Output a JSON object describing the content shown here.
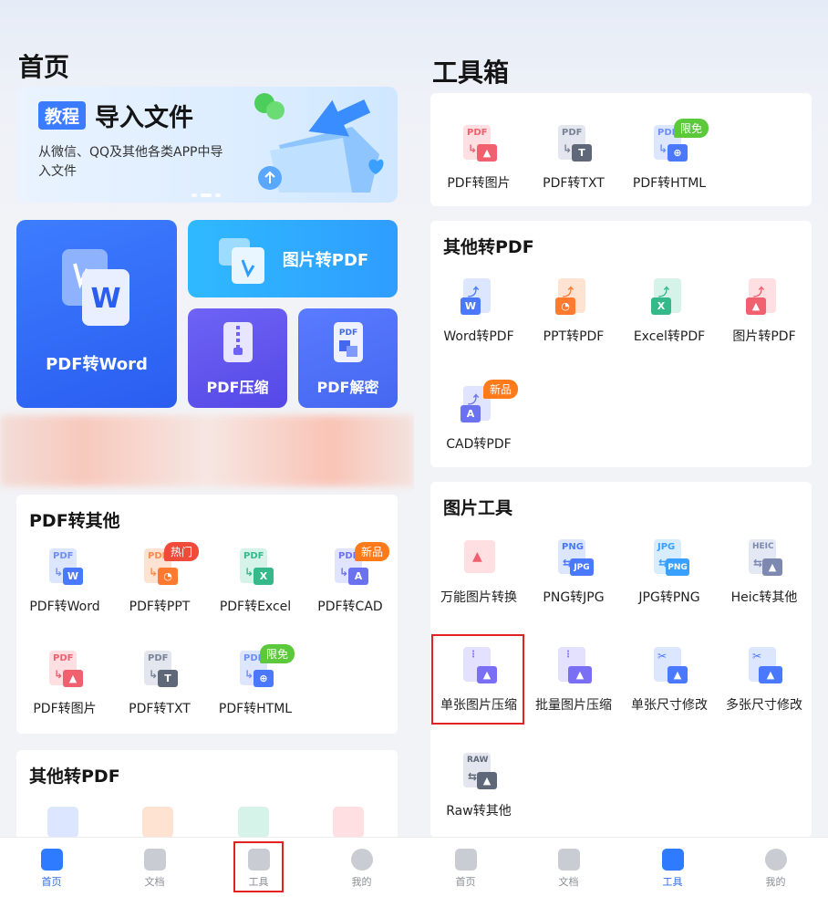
{
  "left": {
    "title": "首页",
    "banner": {
      "tag": "教程",
      "title": "导入文件",
      "subtitle": "从微信、QQ及其他各类APP中导入文件"
    },
    "tiles": {
      "pdf_to_word": "PDF转Word",
      "image_to_pdf": "图片转PDF",
      "pdf_compress": "PDF压缩",
      "pdf_decrypt": "PDF解密"
    },
    "section_pdf_other": {
      "title": "PDF转其他",
      "items": [
        {
          "label": "PDF转Word",
          "icon": "pdf-to-word-icon",
          "badge": ""
        },
        {
          "label": "PDF转PPT",
          "icon": "pdf-to-ppt-icon",
          "badge": "热门"
        },
        {
          "label": "PDF转Excel",
          "icon": "pdf-to-excel-icon",
          "badge": ""
        },
        {
          "label": "PDF转CAD",
          "icon": "pdf-to-cad-icon",
          "badge": "新品"
        },
        {
          "label": "PDF转图片",
          "icon": "pdf-to-image-icon",
          "badge": ""
        },
        {
          "label": "PDF转TXT",
          "icon": "pdf-to-txt-icon",
          "badge": ""
        },
        {
          "label": "PDF转HTML",
          "icon": "pdf-to-html-icon",
          "badge": "限免"
        }
      ]
    },
    "section_other_pdf": {
      "title": "其他转PDF"
    },
    "nav": [
      {
        "label": "首页",
        "icon": "home-icon",
        "active": true
      },
      {
        "label": "文档",
        "icon": "folder-icon",
        "active": false
      },
      {
        "label": "工具",
        "icon": "tools-icon",
        "active": false
      },
      {
        "label": "我的",
        "icon": "profile-icon",
        "active": false
      }
    ]
  },
  "right": {
    "title": "工具箱",
    "top_items": [
      {
        "label": "PDF转图片",
        "badge": ""
      },
      {
        "label": "PDF转TXT",
        "badge": ""
      },
      {
        "label": "PDF转HTML",
        "badge": "限免"
      }
    ],
    "section_other_pdf": {
      "title": "其他转PDF",
      "items": [
        {
          "label": "Word转PDF",
          "badge": ""
        },
        {
          "label": "PPT转PDF",
          "badge": ""
        },
        {
          "label": "Excel转PDF",
          "badge": ""
        },
        {
          "label": "图片转PDF",
          "badge": ""
        },
        {
          "label": "CAD转PDF",
          "badge": "新品"
        }
      ]
    },
    "section_image_tools": {
      "title": "图片工具",
      "items": [
        {
          "label": "万能图片转换",
          "badge": ""
        },
        {
          "label": "PNG转JPG",
          "badge": ""
        },
        {
          "label": "JPG转PNG",
          "badge": ""
        },
        {
          "label": "Heic转其他",
          "badge": ""
        },
        {
          "label": "单张图片压缩",
          "badge": ""
        },
        {
          "label": "批量图片压缩",
          "badge": ""
        },
        {
          "label": "单张尺寸修改",
          "badge": ""
        },
        {
          "label": "多张尺寸修改",
          "badge": ""
        },
        {
          "label": "Raw转其他",
          "badge": ""
        }
      ]
    },
    "nav": [
      {
        "label": "首页",
        "icon": "home-icon",
        "active": false
      },
      {
        "label": "文档",
        "icon": "folder-icon",
        "active": false
      },
      {
        "label": "工具",
        "icon": "tools-icon",
        "active": true
      },
      {
        "label": "我的",
        "icon": "profile-icon",
        "active": false
      }
    ]
  },
  "icon_text": {
    "pdf": "PDF",
    "png": "PNG",
    "jpg": "JPG",
    "heic": "HEIC",
    "raw": "RAW",
    "w": "W",
    "t": "T",
    "x": "X",
    "a": "A"
  },
  "colors": {
    "primary": "#2f7bff",
    "hot": "#f04b3a",
    "new": "#ff7a1a",
    "free": "#5cc93b",
    "highlight": "#e02222"
  }
}
